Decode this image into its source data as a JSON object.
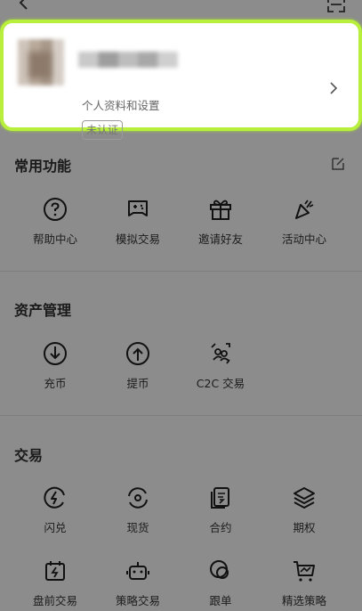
{
  "profile": {
    "subtitle": "个人资料和设置",
    "badge": "未认证"
  },
  "sections": {
    "common": {
      "title": "常用功能",
      "items": [
        {
          "label": "帮助中心",
          "icon": "help-icon"
        },
        {
          "label": "模拟交易",
          "icon": "gamepad-icon"
        },
        {
          "label": "邀请好友",
          "icon": "gift-icon"
        },
        {
          "label": "活动中心",
          "icon": "party-popper-icon"
        }
      ]
    },
    "assets": {
      "title": "资产管理",
      "items": [
        {
          "label": "充币",
          "icon": "deposit-icon"
        },
        {
          "label": "提币",
          "icon": "withdraw-icon"
        },
        {
          "label": "C2C 交易",
          "icon": "c2c-icon"
        }
      ]
    },
    "trade": {
      "title": "交易",
      "items": [
        {
          "label": "闪兑",
          "icon": "flash-convert-icon"
        },
        {
          "label": "现货",
          "icon": "spot-icon"
        },
        {
          "label": "合约",
          "icon": "contract-icon"
        },
        {
          "label": "期权",
          "icon": "options-layers-icon"
        },
        {
          "label": "盘前交易",
          "icon": "premarket-icon"
        },
        {
          "label": "策略交易",
          "icon": "bot-icon"
        },
        {
          "label": "跟单",
          "icon": "copy-trade-icon"
        },
        {
          "label": "精选策略",
          "icon": "cart-chart-icon"
        }
      ]
    }
  },
  "colors": {
    "overlay": "#8c8c8c",
    "highlight_border": "#b8ee3c"
  }
}
